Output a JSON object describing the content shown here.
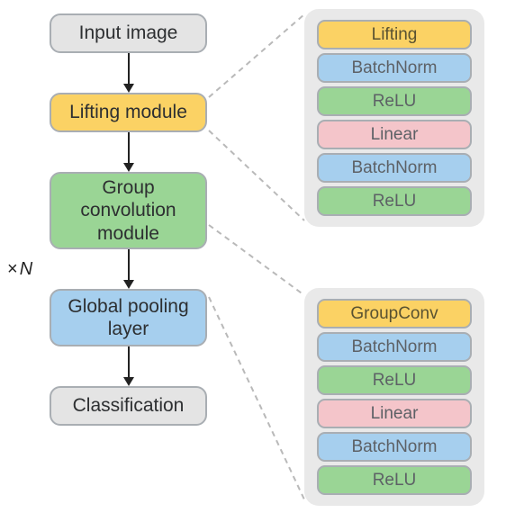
{
  "flow": {
    "input": "Input image",
    "lifting": "Lifting module",
    "group": "Group convolution module",
    "pool": "Global pooling layer",
    "class": "Classification",
    "repeat_prefix": "×",
    "repeat_var": "N"
  },
  "lifting_detail": {
    "l1": "Lifting",
    "l2": "BatchNorm",
    "l3": "ReLU",
    "l4": "Linear",
    "l5": "BatchNorm",
    "l6": "ReLU"
  },
  "group_detail": {
    "g1": "GroupConv",
    "g2": "BatchNorm",
    "g3": "ReLU",
    "g4": "Linear",
    "g5": "BatchNorm",
    "g6": "ReLU"
  }
}
